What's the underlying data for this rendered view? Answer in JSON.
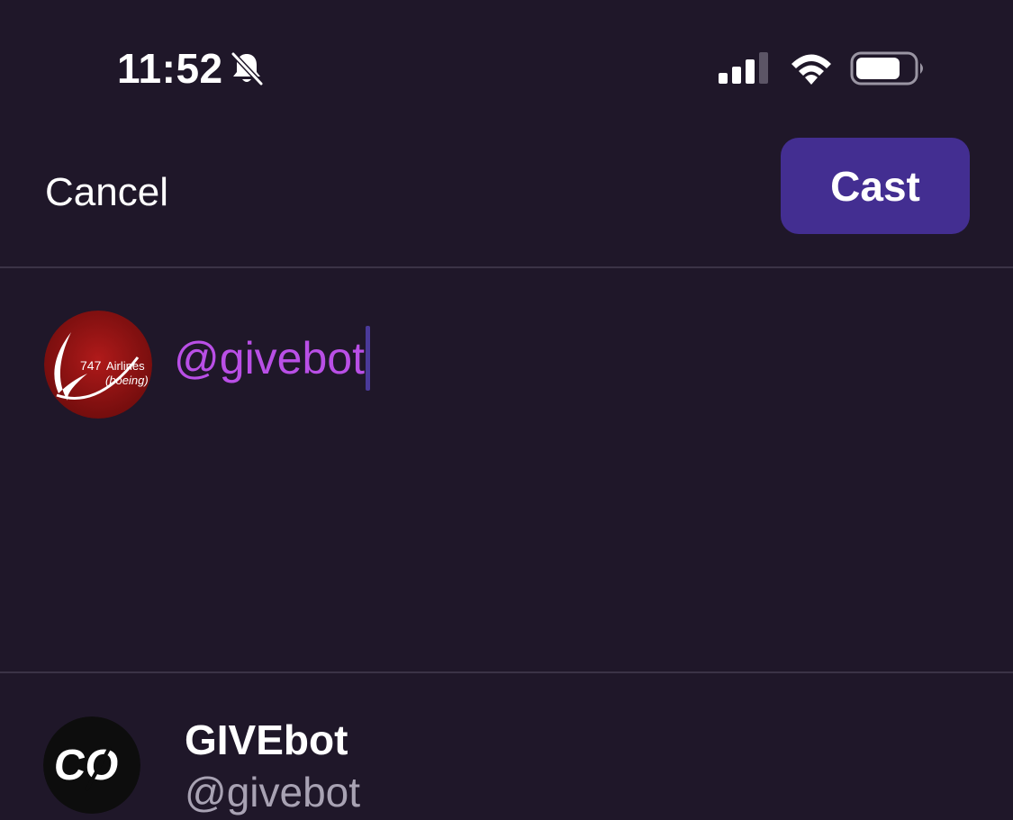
{
  "status_bar": {
    "time": "11:52",
    "icons": [
      "bell-slash-icon",
      "cellular-signal-icon",
      "wifi-icon",
      "battery-icon"
    ]
  },
  "nav": {
    "cancel_label": "Cancel",
    "cast_label": "Cast"
  },
  "composer": {
    "text": "@givebot",
    "avatar": {
      "badge_main": "747",
      "badge_word": "Airlines",
      "badge_sub": "(boeing)"
    }
  },
  "suggestion": {
    "name": "GIVEbot",
    "handle": "@givebot",
    "avatar_text": "CO"
  },
  "colors": {
    "background": "#1f1729",
    "cast_button": "#432e91",
    "mention_text": "#b94fe6",
    "handle_text": "#a8a2b3",
    "divider": "#3b3346"
  }
}
